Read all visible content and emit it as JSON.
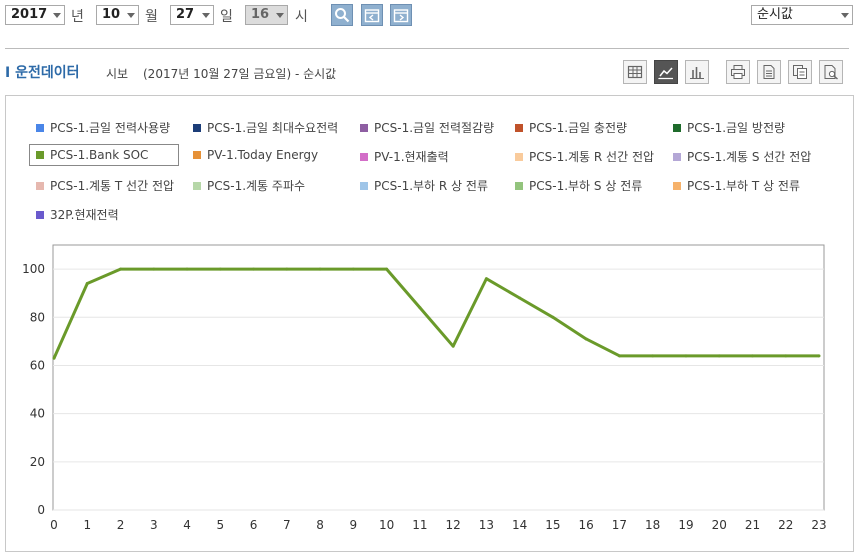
{
  "toolbar": {
    "year": "2017",
    "year_unit": "년",
    "month": "10",
    "month_unit": "월",
    "day": "27",
    "day_unit": "일",
    "hour": "16",
    "hour_unit": "시",
    "mode_select": "순시값"
  },
  "section": {
    "title": "I 운전데이터",
    "sub1": "시보",
    "sub2": "(2017년 10월 27일 금요일) - 순시값"
  },
  "legend": [
    {
      "label": "PCS-1.금일 전력사용량",
      "color": "#4a86e8"
    },
    {
      "label": "PCS-1.금일 최대수요전력",
      "color": "#1c3d78"
    },
    {
      "label": "PCS-1.금일 전력절감량",
      "color": "#8e5ea2"
    },
    {
      "label": "PCS-1.금일 충전량",
      "color": "#c0522a"
    },
    {
      "label": "PCS-1.금일 방전량",
      "color": "#1e6b2b"
    },
    {
      "label": "PCS-1.Bank SOC",
      "color": "#6a9a2a"
    },
    {
      "label": "PV-1.Today Energy",
      "color": "#e69138"
    },
    {
      "label": "PV-1.현재출력",
      "color": "#d36ec8"
    },
    {
      "label": "PCS-1.계통 R 선간 전압",
      "color": "#f9cb9c"
    },
    {
      "label": "PCS-1.계통 S 선간 전압",
      "color": "#b4a7d6"
    },
    {
      "label": "PCS-1.계통 T 선간 전압",
      "color": "#e6b8af"
    },
    {
      "label": "PCS-1.계통 주파수",
      "color": "#b6d7a8"
    },
    {
      "label": "PCS-1.부하 R 상 전류",
      "color": "#9fc5e8"
    },
    {
      "label": "PCS-1.부하 S 상 전류",
      "color": "#93c47d"
    },
    {
      "label": "PCS-1.부하 T 상 전류",
      "color": "#f6b26b"
    },
    {
      "label": "32P.현재전력",
      "color": "#6a5acd"
    }
  ],
  "chart_data": {
    "type": "line",
    "x": [
      0,
      1,
      2,
      3,
      4,
      5,
      6,
      7,
      8,
      9,
      10,
      11,
      12,
      13,
      14,
      15,
      16,
      17,
      18,
      19,
      20,
      21,
      22,
      23
    ],
    "xticks": [
      "0",
      "1",
      "2",
      "3",
      "4",
      "5",
      "6",
      "7",
      "8",
      "9",
      "10",
      "11",
      "12",
      "13",
      "14",
      "15",
      "16",
      "17",
      "18",
      "19",
      "20",
      "21",
      "22",
      "23"
    ],
    "series": [
      {
        "name": "PCS-1.Bank SOC",
        "color": "#6a9a2a",
        "values": [
          63,
          94,
          100,
          100,
          100,
          100,
          100,
          100,
          100,
          100,
          100,
          84,
          68,
          96,
          88,
          80,
          71,
          64,
          64,
          64,
          64,
          64,
          64,
          64
        ]
      }
    ],
    "ylim": [
      0,
      110
    ],
    "yticks": [
      "0",
      "20",
      "40",
      "60",
      "80",
      "100"
    ],
    "grid": true
  }
}
